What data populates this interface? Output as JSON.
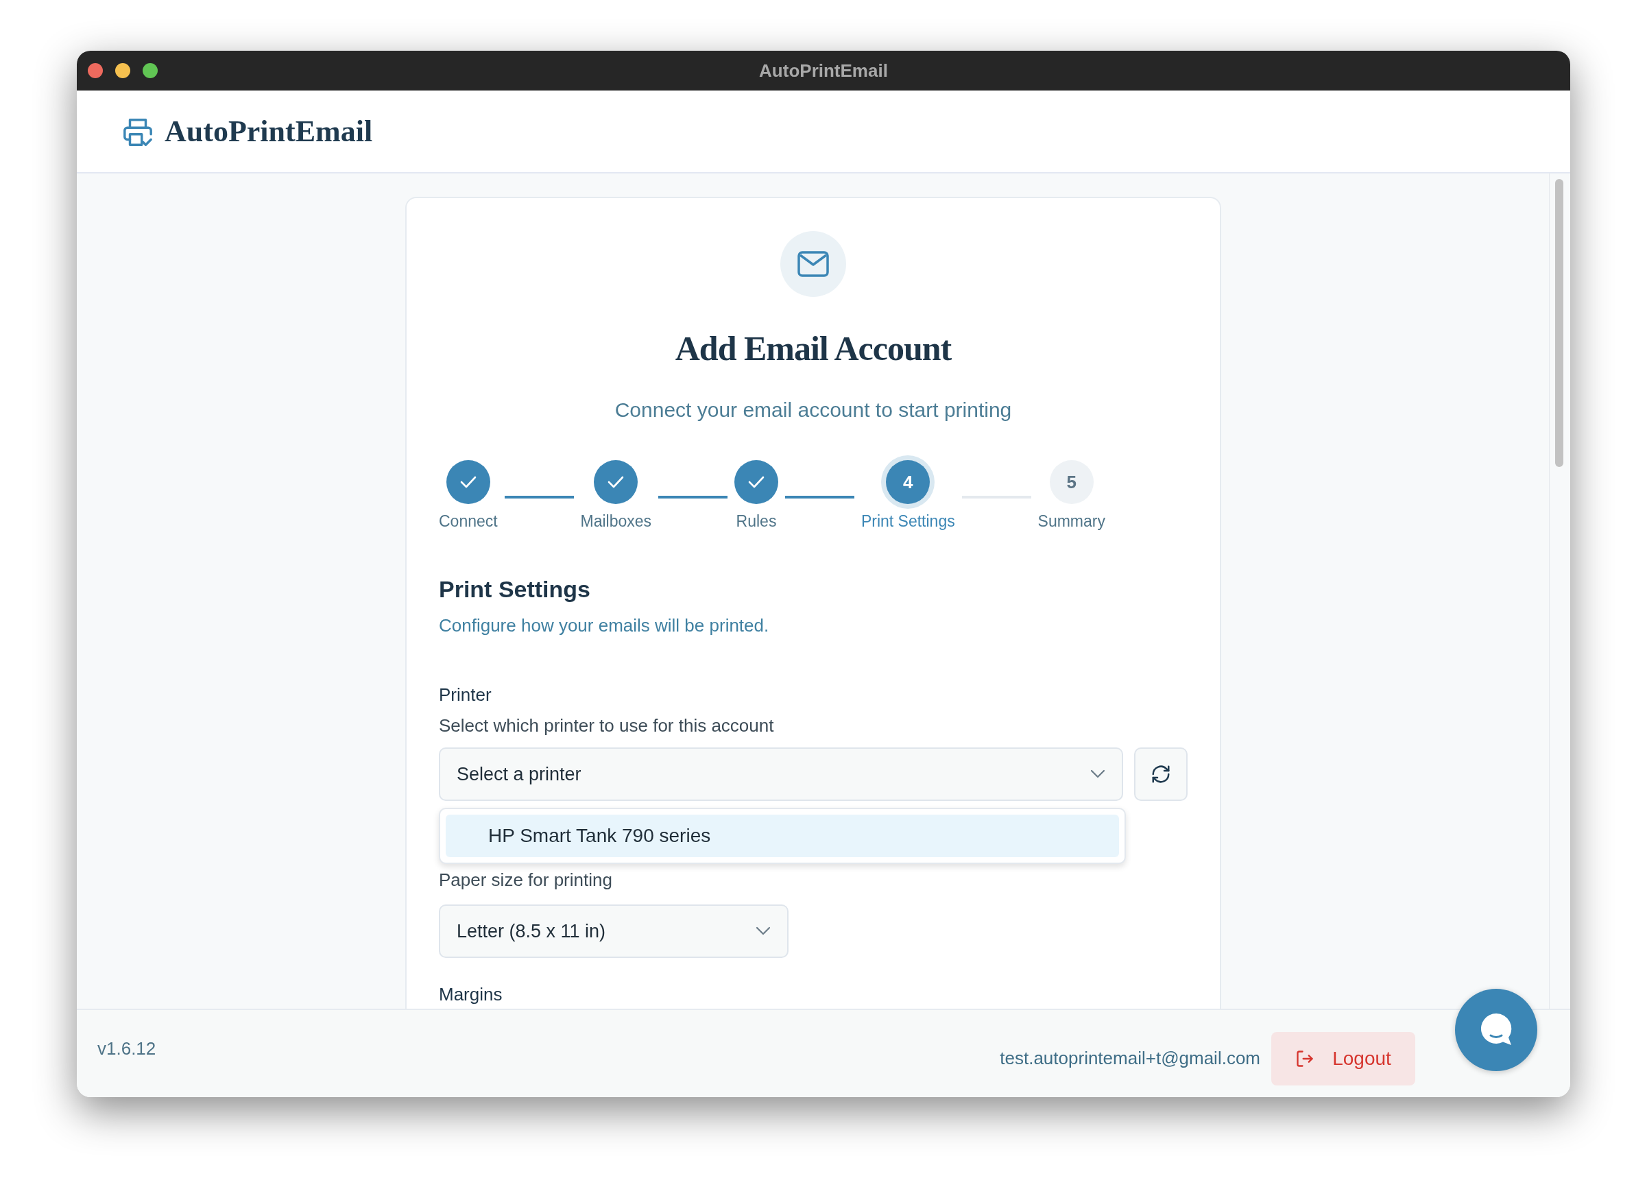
{
  "window": {
    "title": "AutoPrintEmail"
  },
  "header": {
    "app_name": "AutoPrintEmail"
  },
  "card": {
    "title": "Add Email Account",
    "subtitle": "Connect your email account to start printing",
    "steps": [
      {
        "label": "Connect",
        "completed": true,
        "selected": false
      },
      {
        "label": "Mailboxes",
        "completed": true,
        "selected": false
      },
      {
        "label": "Rules",
        "completed": true,
        "selected": false
      },
      {
        "label": "Print Settings",
        "number": "4",
        "completed": false,
        "selected": true
      },
      {
        "label": "Summary",
        "number": "5",
        "completed": false,
        "selected": false
      }
    ],
    "section": {
      "title": "Print Settings",
      "description": "Configure how your emails will be printed."
    },
    "printer": {
      "label": "Printer",
      "description": "Select which printer to use for this account",
      "placeholder": "Select a printer",
      "options": [
        {
          "label": "HP Smart Tank 790 series",
          "highlighted": true
        }
      ]
    },
    "paper": {
      "description": "Paper size for printing",
      "value": "Letter (8.5 x 11 in)"
    },
    "margins": {
      "label": "Margins"
    }
  },
  "footer": {
    "version": "v1.6.12",
    "email": "test.autoprintemail+t@gmail.com",
    "logout": "Logout"
  }
}
